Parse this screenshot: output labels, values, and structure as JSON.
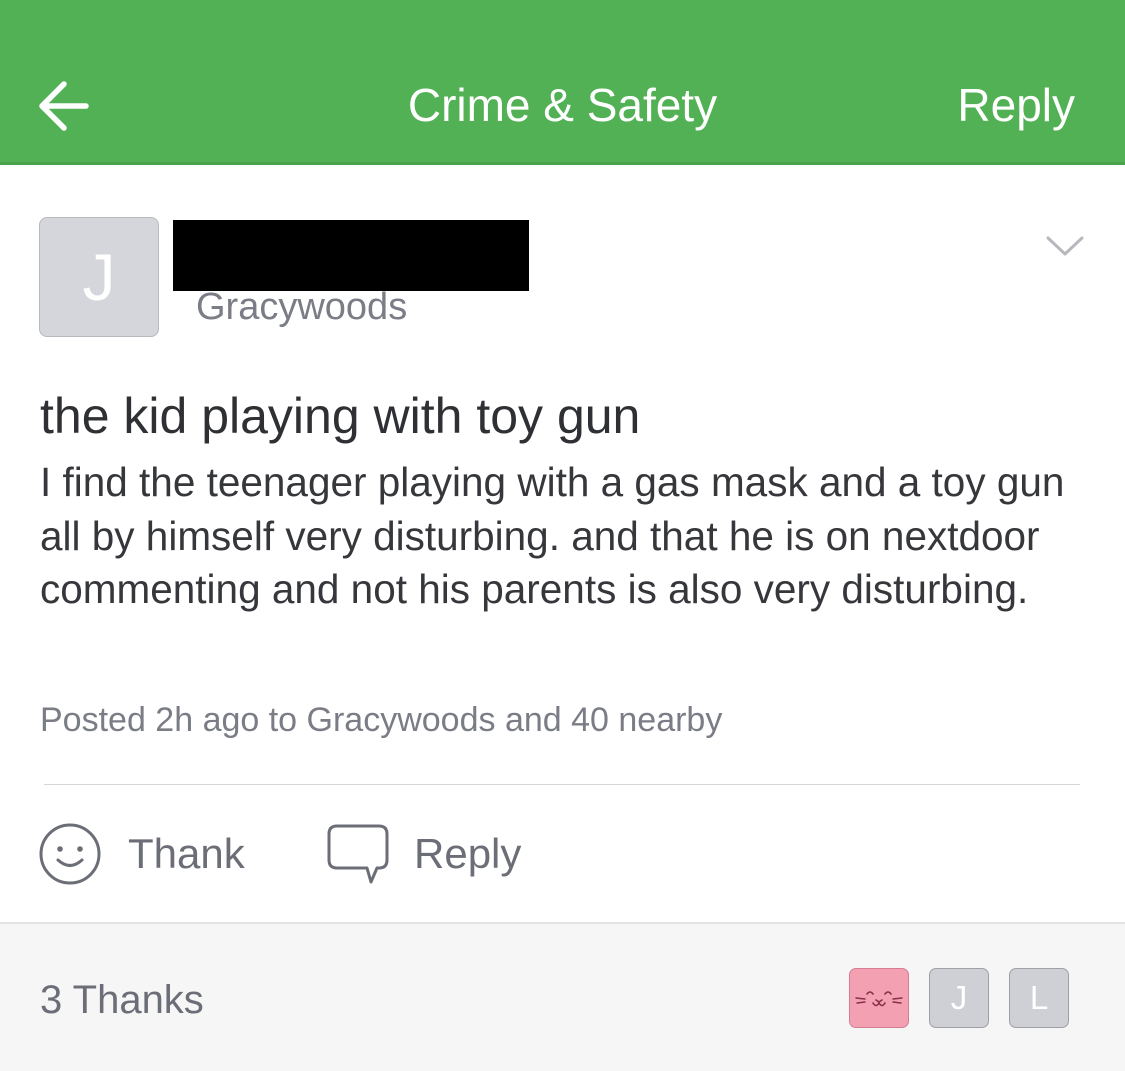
{
  "colors": {
    "header_green": "#52b155",
    "header_text": "#ffffff",
    "muted_text": "#7b7d86",
    "body_text": "#36373b",
    "footer_bg": "#f6f6f7",
    "avatar_gray": "#d5d6db",
    "thanker_pink": "#f2a0b2"
  },
  "header": {
    "back_icon": "arrow-left-icon",
    "title": "Crime & Safety",
    "reply_label": "Reply"
  },
  "post": {
    "author": {
      "avatar_initial": "J",
      "name": "",
      "neighborhood": "Gracywoods"
    },
    "menu_icon": "chevron-down-icon",
    "title": "the kid playing with toy gun",
    "body": "I find the teenager playing with a gas mask and a toy gun all by himself very disturbing.  and that he is on nextdoor commenting and not his parents is also very disturbing.",
    "meta": "Posted 2h ago to Gracywoods and 40 nearby"
  },
  "actions": {
    "thank": {
      "icon": "smiley-icon",
      "label": "Thank"
    },
    "reply": {
      "icon": "speech-bubble-icon",
      "label": "Reply"
    }
  },
  "footer": {
    "thanks_count": "3 Thanks",
    "thankers": [
      {
        "type": "image",
        "icon": "cat-face-icon"
      },
      {
        "type": "initial",
        "initial": "J"
      },
      {
        "type": "initial",
        "initial": "L"
      }
    ]
  }
}
